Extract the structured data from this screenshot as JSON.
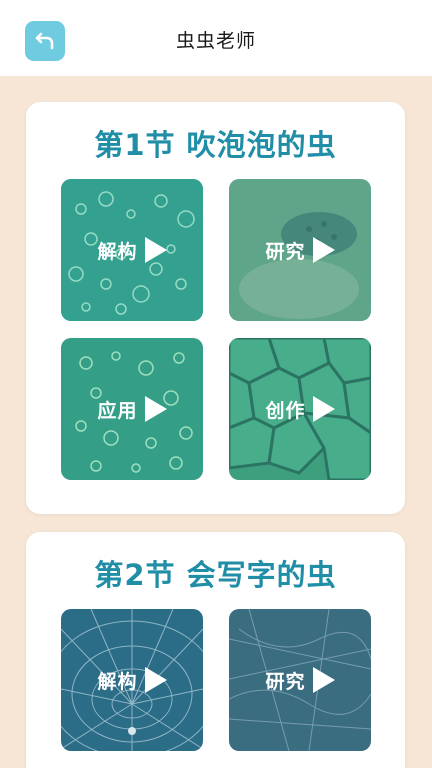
{
  "header": {
    "title": "虫虫老师",
    "back_icon": "back-arrow-icon",
    "accent": "#6fcbe0"
  },
  "sections": [
    {
      "title": "第1节 吹泡泡的虫",
      "tiles": [
        {
          "label": "解构",
          "theme": "bubbles"
        },
        {
          "label": "研究",
          "theme": "insect"
        },
        {
          "label": "应用",
          "theme": "bubbles"
        },
        {
          "label": "创作",
          "theme": "cells"
        }
      ]
    },
    {
      "title": "第2节 会写字的虫",
      "tiles": [
        {
          "label": "解构",
          "theme": "web"
        },
        {
          "label": "研究",
          "theme": "web-dark"
        }
      ]
    }
  ],
  "colors": {
    "background": "#f7e6d5",
    "title": "#1f8ea6",
    "tile_green": "#3a9f88",
    "tile_blue": "#2e6f8a"
  }
}
